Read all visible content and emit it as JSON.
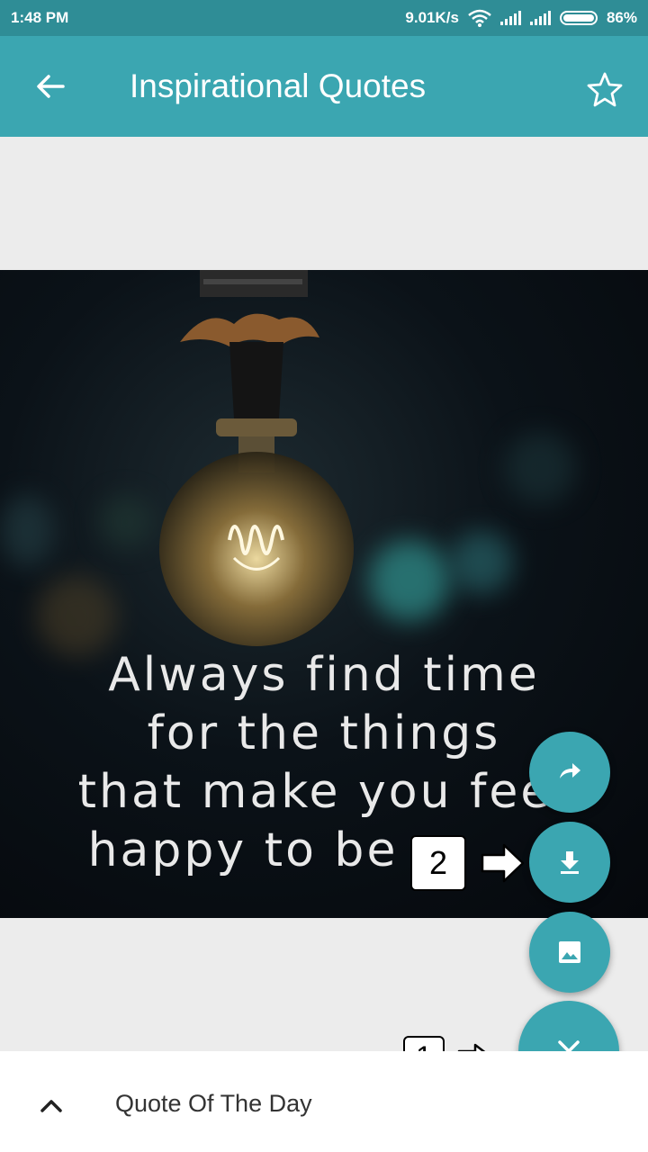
{
  "status_bar": {
    "time": "1:48 PM",
    "speed": "9.01K/s",
    "battery": "86%",
    "icons": [
      "wifi-icon",
      "signal-icon",
      "signal-icon",
      "battery-icon"
    ]
  },
  "app_bar": {
    "title": "Inspirational Quotes",
    "back_icon": "arrow-back-icon",
    "favorite_icon": "star-outline-icon"
  },
  "quote": {
    "lines": [
      "Always find time",
      "for the things",
      "that make you fee",
      "happy to be"
    ]
  },
  "fabs": {
    "share_icon": "share-icon",
    "download_icon": "download-icon",
    "set_wallpaper_icon": "image-icon",
    "close_icon": "close-icon"
  },
  "annotations": {
    "marker_1": "1",
    "marker_2": "2"
  },
  "bottom_sheet": {
    "title": "Quote Of The Day",
    "toggle_icon": "chevron-up-icon"
  },
  "colors": {
    "primary": "#3ba6b1",
    "status_bar": "#2f8d96"
  }
}
